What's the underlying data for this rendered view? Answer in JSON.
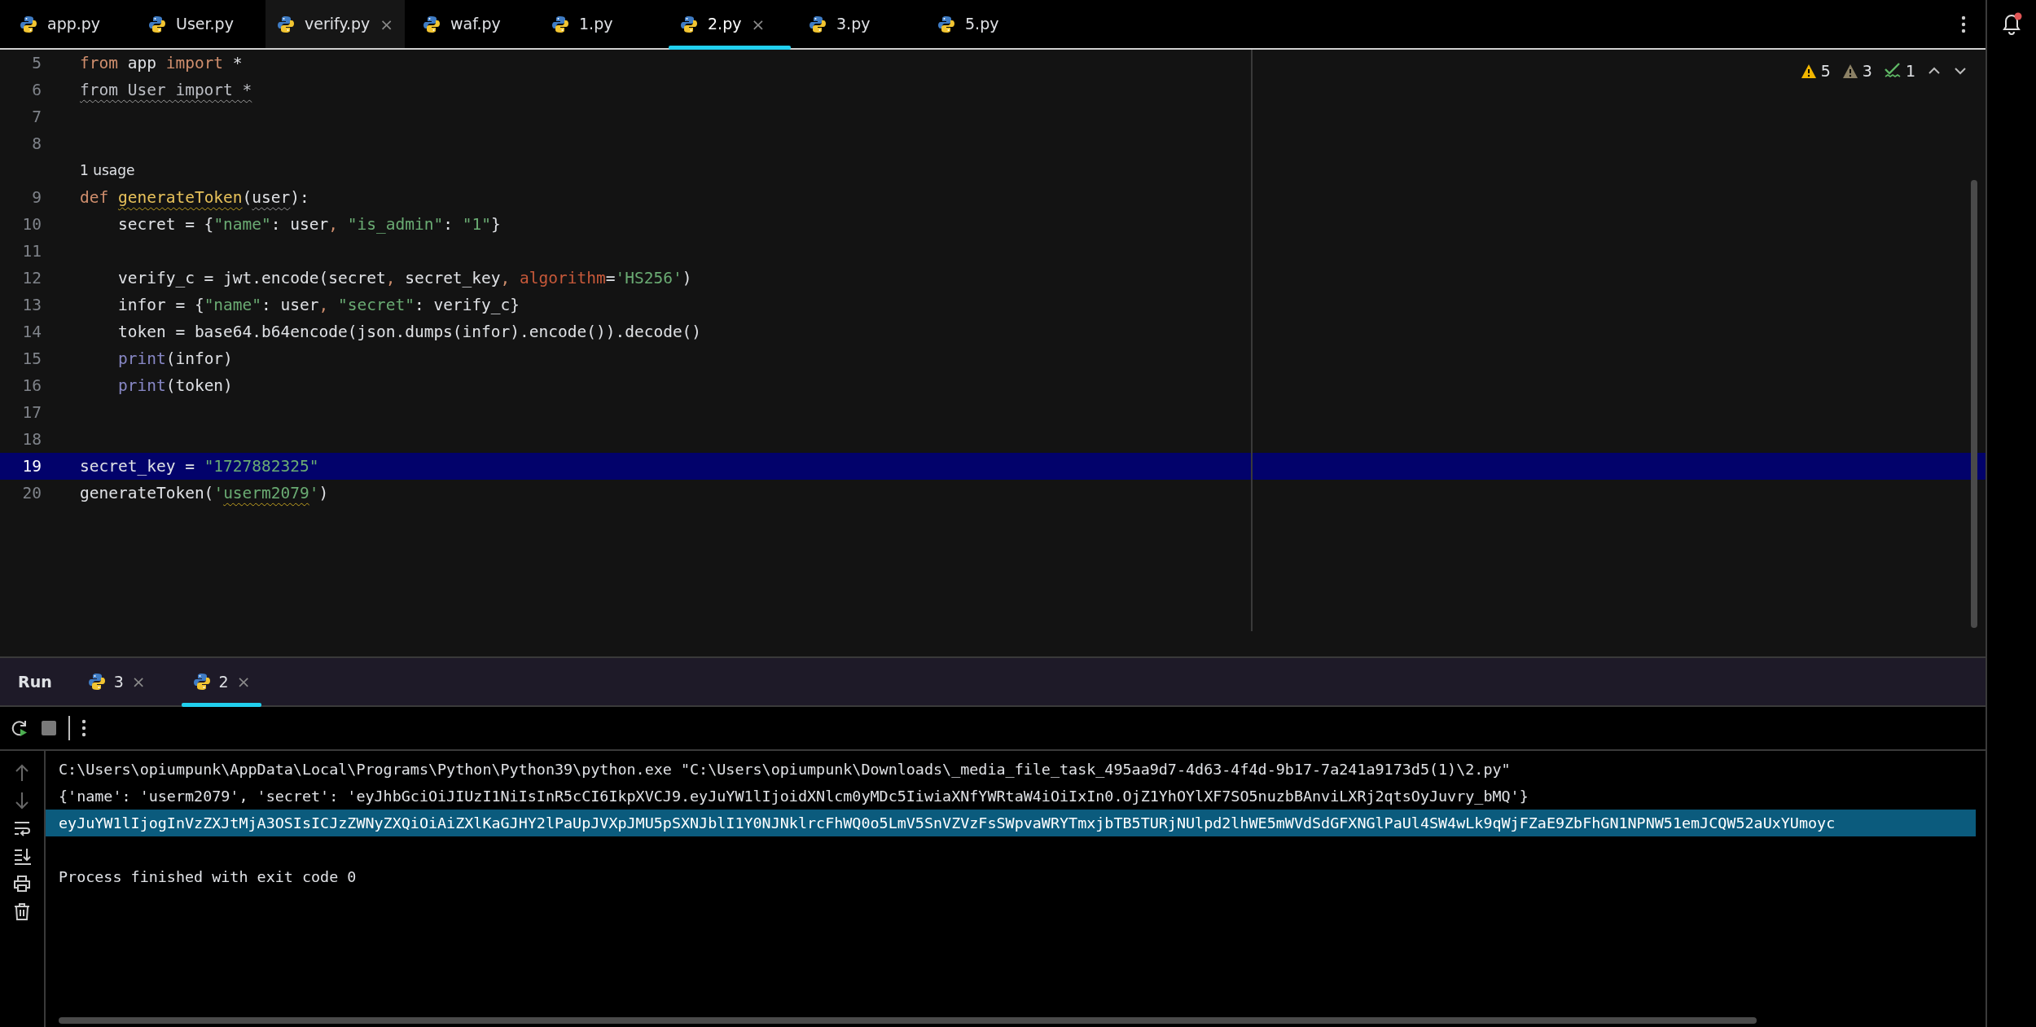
{
  "tabs": [
    {
      "label": "app.py",
      "selected": false
    },
    {
      "label": "User.py",
      "selected": false
    },
    {
      "label": "verify.py",
      "selected": false,
      "close": "×"
    },
    {
      "label": "waf.py",
      "selected": false
    },
    {
      "label": "1.py",
      "selected": false
    },
    {
      "label": "2.py",
      "selected": true,
      "close": "×"
    },
    {
      "label": "3.py",
      "selected": false
    },
    {
      "label": "5.py",
      "selected": false
    }
  ],
  "inspections": [
    {
      "kind": "warning",
      "count": "5"
    },
    {
      "kind": "weak-warning",
      "count": "3"
    },
    {
      "kind": "typo",
      "count": "1"
    }
  ],
  "code_lines": [
    {
      "kind": "code",
      "number": "5",
      "highlighted": false,
      "tokens": [
        {
          "text": "from",
          "kind": "kw"
        },
        {
          "text": " app ",
          "kind": "plain"
        },
        {
          "text": "import",
          "kind": "kw"
        },
        {
          "text": " *",
          "kind": "plain"
        }
      ]
    },
    {
      "kind": "code",
      "number": "6",
      "highlighted": false,
      "tokens": [
        {
          "text": "from User import *",
          "kind": "dim",
          "wavy": true
        }
      ]
    },
    {
      "kind": "code",
      "number": "7",
      "highlighted": false
    },
    {
      "kind": "code",
      "number": "8",
      "highlighted": false
    },
    {
      "kind": "hint",
      "text": "1 usage",
      "highlighted": false
    },
    {
      "kind": "code",
      "number": "9",
      "highlighted": false,
      "tokens": [
        {
          "text": "def ",
          "kind": "kw"
        },
        {
          "text": "generateToken",
          "kind": "fn",
          "wavy": true
        },
        {
          "text": "(",
          "kind": "plain"
        },
        {
          "text": "user",
          "kind": "plain",
          "wavy": true
        },
        {
          "text": "):",
          "kind": "plain"
        }
      ]
    },
    {
      "kind": "code",
      "number": "10",
      "highlighted": false,
      "tokens": [
        {
          "text": "    secret = {",
          "kind": "plain"
        },
        {
          "text": "\"name\"",
          "kind": "str"
        },
        {
          "text": ": user",
          "kind": "plain"
        },
        {
          "text": ", ",
          "kind": "kw"
        },
        {
          "text": "\"is_admin\"",
          "kind": "str"
        },
        {
          "text": ": ",
          "kind": "plain"
        },
        {
          "text": "\"1\"",
          "kind": "str"
        },
        {
          "text": "}",
          "kind": "plain"
        }
      ]
    },
    {
      "kind": "code",
      "number": "11",
      "highlighted": false
    },
    {
      "kind": "code",
      "number": "12",
      "highlighted": false,
      "tokens": [
        {
          "text": "    verify_c = jwt.encode(secret",
          "kind": "plain"
        },
        {
          "text": ", ",
          "kind": "kw"
        },
        {
          "text": "secret_key",
          "kind": "plain"
        },
        {
          "text": ", ",
          "kind": "kw"
        },
        {
          "text": "algorithm",
          "kind": "param"
        },
        {
          "text": "=",
          "kind": "plain"
        },
        {
          "text": "'HS256'",
          "kind": "str"
        },
        {
          "text": ")",
          "kind": "plain"
        }
      ]
    },
    {
      "kind": "code",
      "number": "13",
      "highlighted": false,
      "tokens": [
        {
          "text": "    infor = {",
          "kind": "plain"
        },
        {
          "text": "\"name\"",
          "kind": "str"
        },
        {
          "text": ": user",
          "kind": "plain"
        },
        {
          "text": ", ",
          "kind": "kw"
        },
        {
          "text": "\"secret\"",
          "kind": "str"
        },
        {
          "text": ": verify_c}",
          "kind": "plain"
        }
      ]
    },
    {
      "kind": "code",
      "number": "14",
      "highlighted": false,
      "tokens": [
        {
          "text": "    token = base64.b64encode(json.dumps(infor).encode()).decode()",
          "kind": "plain"
        }
      ]
    },
    {
      "kind": "code",
      "number": "15",
      "highlighted": false,
      "tokens": [
        {
          "text": "    print",
          "kind": "builtin"
        },
        {
          "text": "(infor)",
          "kind": "plain"
        }
      ]
    },
    {
      "kind": "code",
      "number": "16",
      "highlighted": false,
      "tokens": [
        {
          "text": "    print",
          "kind": "builtin"
        },
        {
          "text": "(token)",
          "kind": "plain"
        }
      ]
    },
    {
      "kind": "code",
      "number": "17",
      "highlighted": false
    },
    {
      "kind": "code",
      "number": "18",
      "highlighted": false
    },
    {
      "kind": "code",
      "number": "19",
      "highlighted": true,
      "tokens": [
        {
          "text": "secret_key = ",
          "kind": "plain"
        },
        {
          "text": "\"1727882325\"",
          "kind": "str"
        }
      ]
    },
    {
      "kind": "code",
      "number": "20",
      "highlighted": false,
      "tokens": [
        {
          "text": "generateToken(",
          "kind": "plain"
        },
        {
          "text": "'",
          "kind": "str"
        },
        {
          "text": "userm2079",
          "kind": "str",
          "wavy": true
        },
        {
          "text": "'",
          "kind": "str"
        },
        {
          "text": ")",
          "kind": "plain"
        }
      ]
    }
  ],
  "run_panel": {
    "title": "Run",
    "tabs": [
      {
        "label": "3",
        "selected": false,
        "close": "×"
      },
      {
        "label": "2",
        "selected": true,
        "close": "×"
      }
    ],
    "output": [
      {
        "text": "C:\\Users\\opiumpunk\\AppData\\Local\\Programs\\Python\\Python39\\python.exe \"C:\\Users\\opiumpunk\\Downloads\\_media_file_task_495aa9d7-4d63-4f4d-9b17-7a241a9173d5(1)\\2.py\"",
        "highlighted": false
      },
      {
        "text": "{'name': 'userm2079', 'secret': 'eyJhbGciOiJIUzI1NiIsInR5cCI6IkpXVCJ9.eyJuYW1lIjoidXNlcm0yMDc5IiwiaXNfYWRtaW4iOiIxIn0.OjZ1YhOYlXF7SO5nuzbBAnviLXRj2qtsOyJuvry_bMQ'}",
        "highlighted": false
      },
      {
        "text": "eyJuYW1lIjogInVzZXJtMjA3OSIsICJzZWNyZXQiOiAiZXlKaGJHY2lPaUpJVXpJMU5pSXNJblI1Y0NJNklrcFhWQ0o5LmV5SnVZVzFsSWpvaWRYTmxjbTB5TURjNUlpd2lhWE5mWVdSdGFXNGlPaUl4SW4wLk9qWjFZaE9ZbFhGN1NPNW51emJCQW52aUxYUmoyc",
        "highlighted": true
      },
      {
        "highlighted": false
      },
      {
        "text": "Process finished with exit code 0",
        "highlighted": false
      }
    ]
  }
}
